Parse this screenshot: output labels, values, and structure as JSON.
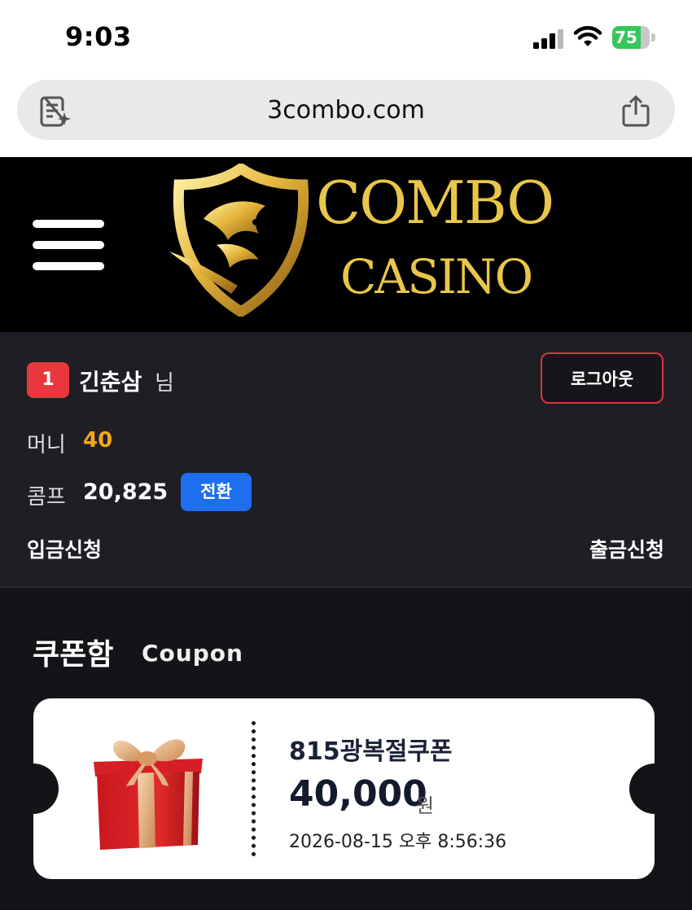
{
  "status_bar": {
    "time": "9:03",
    "battery_level": "75",
    "battery_percent": 75
  },
  "browser": {
    "url": "3combo.com"
  },
  "header": {
    "logo_line1": "COMBO",
    "logo_line2": "CASINO",
    "colors": {
      "background": "#000000",
      "gold": "#e8c64a"
    }
  },
  "user": {
    "level": "1",
    "name": "긴춘삼",
    "honorific": "님",
    "logout_label": "로그아웃",
    "money_label": "머니",
    "money_value": "40",
    "comp_label": "콤프",
    "comp_value": "20,825",
    "convert_label": "전환",
    "deposit_label": "입금신청",
    "withdraw_label": "출금신청"
  },
  "coupon_section": {
    "title": "쿠폰함",
    "subtitle": "Coupon",
    "coupons": [
      {
        "name": "815광복절쿠폰",
        "amount": "40,000",
        "unit": "원",
        "expiry": "2026-08-15 오후 8:56:36"
      }
    ]
  },
  "colors": {
    "accent_red": "#e8383d",
    "accent_blue": "#1e6ef0",
    "money_orange": "#f2a71b",
    "panel_bg": "#1e1e24"
  }
}
